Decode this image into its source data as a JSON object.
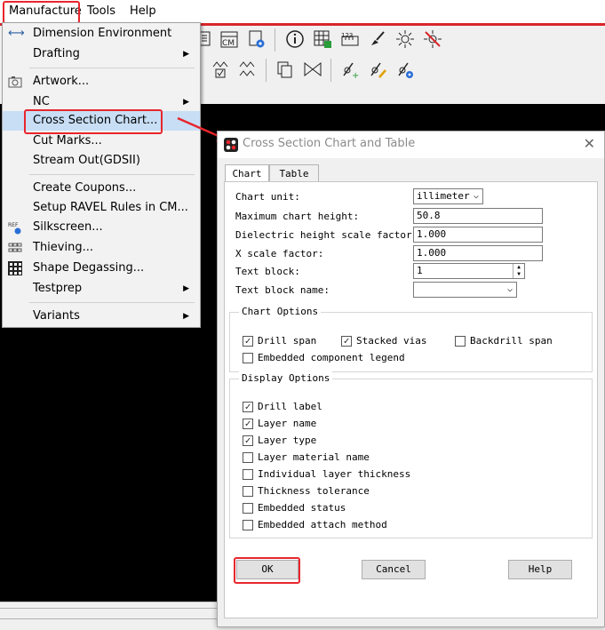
{
  "menubar": {
    "items": [
      "Manufacture",
      "Tools",
      "Help"
    ]
  },
  "toolbar": {
    "row1_icons": [
      "export-icon",
      "cm-icon",
      "gear-doc-icon",
      "info-icon",
      "grid-icon",
      "measure-icon",
      "brush-icon",
      "sun-icon",
      "sun-off-icon"
    ],
    "cm_label": "CM",
    "ruler_label": "123"
  },
  "menu": {
    "items": [
      {
        "label": "Dimension Environment",
        "icon": "dimension-icon",
        "submenu": false
      },
      {
        "label": "Drafting",
        "submenu": true
      },
      {
        "label": "Artwork...",
        "icon": "camera-icon",
        "submenu": false
      },
      {
        "label": "NC",
        "submenu": true
      },
      {
        "label": "Cross Section Chart...",
        "submenu": false,
        "highlighted": true
      },
      {
        "label": "Cut Marks...",
        "submenu": false
      },
      {
        "label": "Stream Out(GDSII)",
        "submenu": false
      },
      {
        "label": "Create Coupons...",
        "submenu": false
      },
      {
        "label": "Setup RAVEL Rules in CM...",
        "submenu": false
      },
      {
        "label": "Silkscreen...",
        "icon": "silkscreen-icon",
        "submenu": false
      },
      {
        "label": "Thieving...",
        "icon": "thieving-icon",
        "submenu": false
      },
      {
        "label": "Shape Degassing...",
        "icon": "degassing-icon",
        "submenu": false
      },
      {
        "label": "Testprep",
        "submenu": true
      },
      {
        "label": "Variants",
        "submenu": true
      }
    ]
  },
  "dialog": {
    "title": "Cross Section Chart and Table",
    "tabs": [
      "Chart",
      "Table"
    ],
    "fields": {
      "chart_unit_label": "Chart unit:",
      "chart_unit_value": "illimeter",
      "max_height_label": "Maximum chart height:",
      "max_height_value": "50.8",
      "dielectric_label": "Dielectric height scale factor:",
      "dielectric_value": "1.000",
      "xscale_label": "X scale factor:",
      "xscale_value": "1.000",
      "textblock_label": "Text block:",
      "textblock_value": "1",
      "textblock_name_label": "Text block name:",
      "textblock_name_value": ""
    },
    "chart_options": {
      "title": "Chart Options",
      "items": [
        {
          "label": "Drill span",
          "checked": true
        },
        {
          "label": "Stacked vias",
          "checked": true
        },
        {
          "label": "Backdrill span",
          "checked": false
        },
        {
          "label": "Embedded component legend",
          "checked": false
        }
      ]
    },
    "display_options": {
      "title": "Display Options",
      "items": [
        {
          "label": "Drill label",
          "checked": true
        },
        {
          "label": "Layer name",
          "checked": true
        },
        {
          "label": "Layer type",
          "checked": true
        },
        {
          "label": "Layer material name",
          "checked": false
        },
        {
          "label": "Individual layer thickness",
          "checked": false
        },
        {
          "label": "Thickness tolerance",
          "checked": false
        },
        {
          "label": "Embedded status",
          "checked": false
        },
        {
          "label": "Embedded attach method",
          "checked": false
        }
      ]
    },
    "buttons": {
      "ok": "OK",
      "cancel": "Cancel",
      "help": "Help"
    }
  },
  "colors": {
    "annotation_red": "#e8262d",
    "highlight": "#c8def5",
    "canvas": "#000000"
  }
}
